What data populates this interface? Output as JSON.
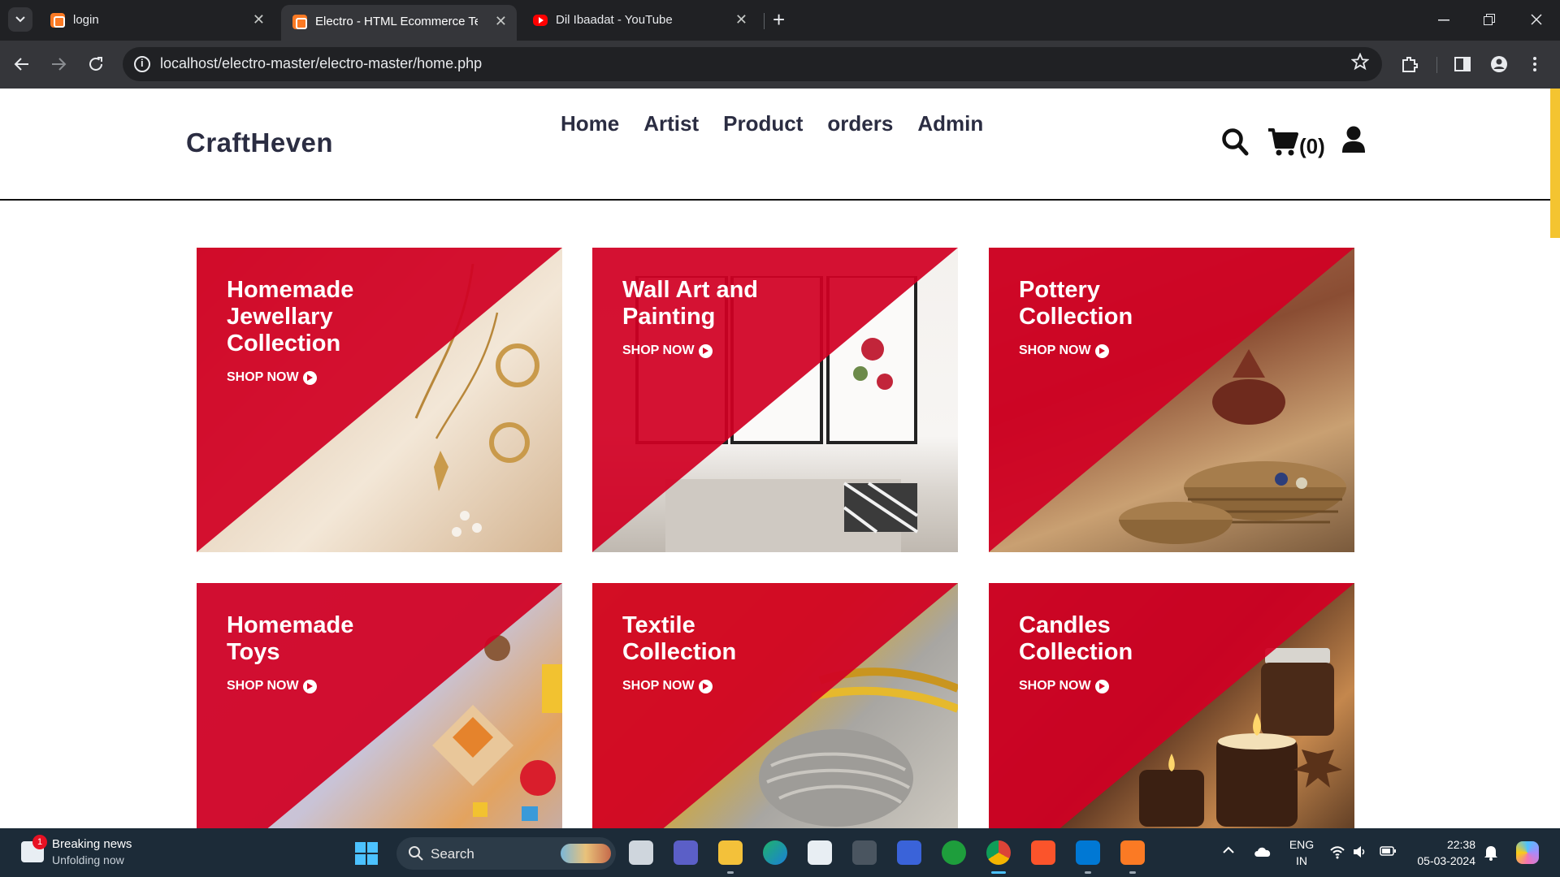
{
  "browser": {
    "tabs": [
      {
        "label": "login",
        "favicon": "xampp-icon"
      },
      {
        "label": "Electro - HTML Ecommerce Template",
        "favicon": "xampp-icon",
        "active": true
      },
      {
        "label": "Dil Ibaadat - YouTube",
        "favicon": "youtube-icon"
      }
    ],
    "close_glyph": "✕",
    "new_tab_glyph": "+",
    "url": "localhost/electro-master/electro-master/home.php"
  },
  "site": {
    "logo": "CraftHeven",
    "nav": [
      "Home",
      "Artist",
      "Product",
      "orders",
      "Admin"
    ],
    "cart_count": "(0)",
    "accent_color": "#d10024"
  },
  "collections": [
    {
      "title": "Homemade Jewellary Collection",
      "cta": "SHOP NOW"
    },
    {
      "title": "Wall Art and Painting",
      "cta": "SHOP NOW"
    },
    {
      "title": "Pottery Collection",
      "cta": "SHOP NOW"
    },
    {
      "title": "Homemade Toys",
      "cta": "SHOP NOW"
    },
    {
      "title": "Textile Collection",
      "cta": "SHOP NOW"
    },
    {
      "title": "Candles Collection",
      "cta": "SHOP NOW"
    }
  ],
  "taskbar": {
    "news_title": "Breaking news",
    "news_subtitle": "Unfolding now",
    "news_badge": "1",
    "search_label": "Search",
    "language_line1": "ENG",
    "language_line2": "IN",
    "time": "22:38",
    "date": "05-03-2024"
  }
}
